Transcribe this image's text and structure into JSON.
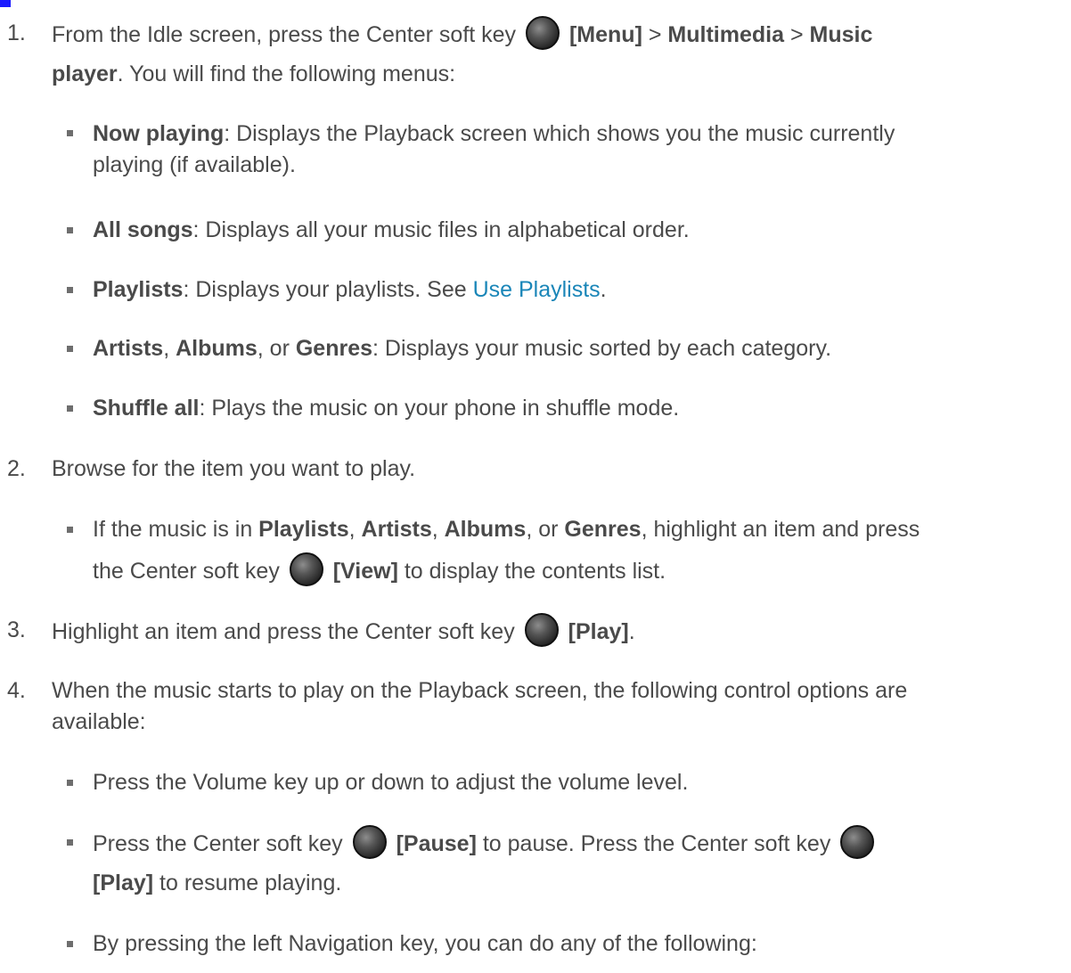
{
  "keys": {
    "center_soft_key_icon": "center-soft-key-icon"
  },
  "steps": [
    {
      "num": "1.",
      "p1": "From the Idle screen, press the Center soft key",
      "b1": "[Menu]",
      "gt1": ">",
      "b2": "Multimedia",
      "gt2": ">",
      "b3": "Music",
      "b4": "player",
      "p2": ". You will find the following menus:",
      "bullets": [
        {
          "b": "Now playing",
          "t1": ": Displays the Playback screen which shows you the music currently",
          "t2": "playing (if available)."
        },
        {
          "b": "All songs",
          "t": ": Displays all your music files in alphabetical order."
        },
        {
          "b": "Playlists",
          "t": ": Displays your playlists. See ",
          "link": "Use Playlists",
          "end": "."
        },
        {
          "b1": "Artists",
          "c1": ", ",
          "b2": "Albums",
          "c2": ", or ",
          "b3": "Genres",
          "t": ": Displays your music sorted by each category."
        },
        {
          "b": "Shuffle all",
          "t": ": Plays the music on your phone in shuffle mode."
        }
      ]
    },
    {
      "num": "2.",
      "text": "Browse for the item you want to play.",
      "bullet": {
        "t1": "If the music is in ",
        "b1": "Playlists",
        "c1": ", ",
        "b2": "Artists",
        "c2": ", ",
        "b3": "Albums",
        "c3": ", or ",
        "b4": "Genres",
        "t2": ", highlight an item and press",
        "t3": "the Center soft key",
        "b5": "[View]",
        "t4": " to display the contents list."
      }
    },
    {
      "num": "3.",
      "t1": "Highlight an item and press the Center soft key",
      "b1": "[Play]",
      "t2": "."
    },
    {
      "num": "4.",
      "l1": "When the music starts to play on the Playback screen, the following control options are",
      "l2": "available:",
      "bullets": [
        {
          "t": "Press the Volume key up or down to adjust the volume level."
        },
        {
          "t1": "Press the Center soft key",
          "b1": "[Pause]",
          "t2": " to pause. Press the Center soft key",
          "b2": "[Play]",
          "t3": " to resume playing."
        },
        {
          "t": "By pressing the left Navigation key, you can do any of the following:"
        }
      ]
    }
  ]
}
